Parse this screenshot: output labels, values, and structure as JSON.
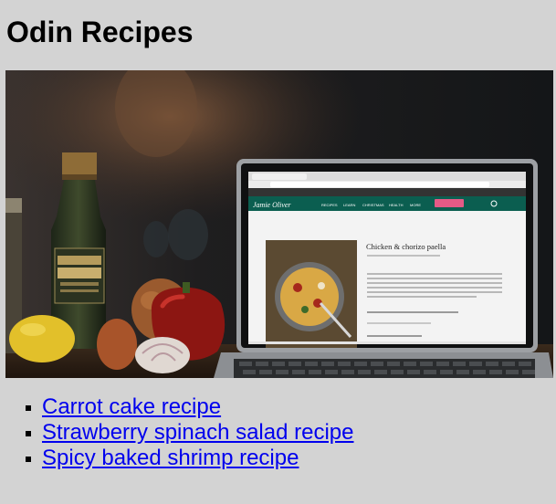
{
  "page": {
    "title": "Odin Recipes"
  },
  "hero": {
    "screen": {
      "site_name": "Jamie Oliver",
      "nav_items": [
        "RECIPES",
        "LEARN",
        "CHRISTMAS",
        "HEALTH",
        "MORE"
      ],
      "recipe_title": "Chicken & chorizo paella"
    }
  },
  "recipes": [
    {
      "label": "Carrot cake recipe"
    },
    {
      "label": "Strawberry spinach salad recipe"
    },
    {
      "label": "Spicy baked shrimp recipe"
    }
  ],
  "colors": {
    "background": "#d3d3d3",
    "link": "#0000ee",
    "site_header": "#0b5e50"
  }
}
